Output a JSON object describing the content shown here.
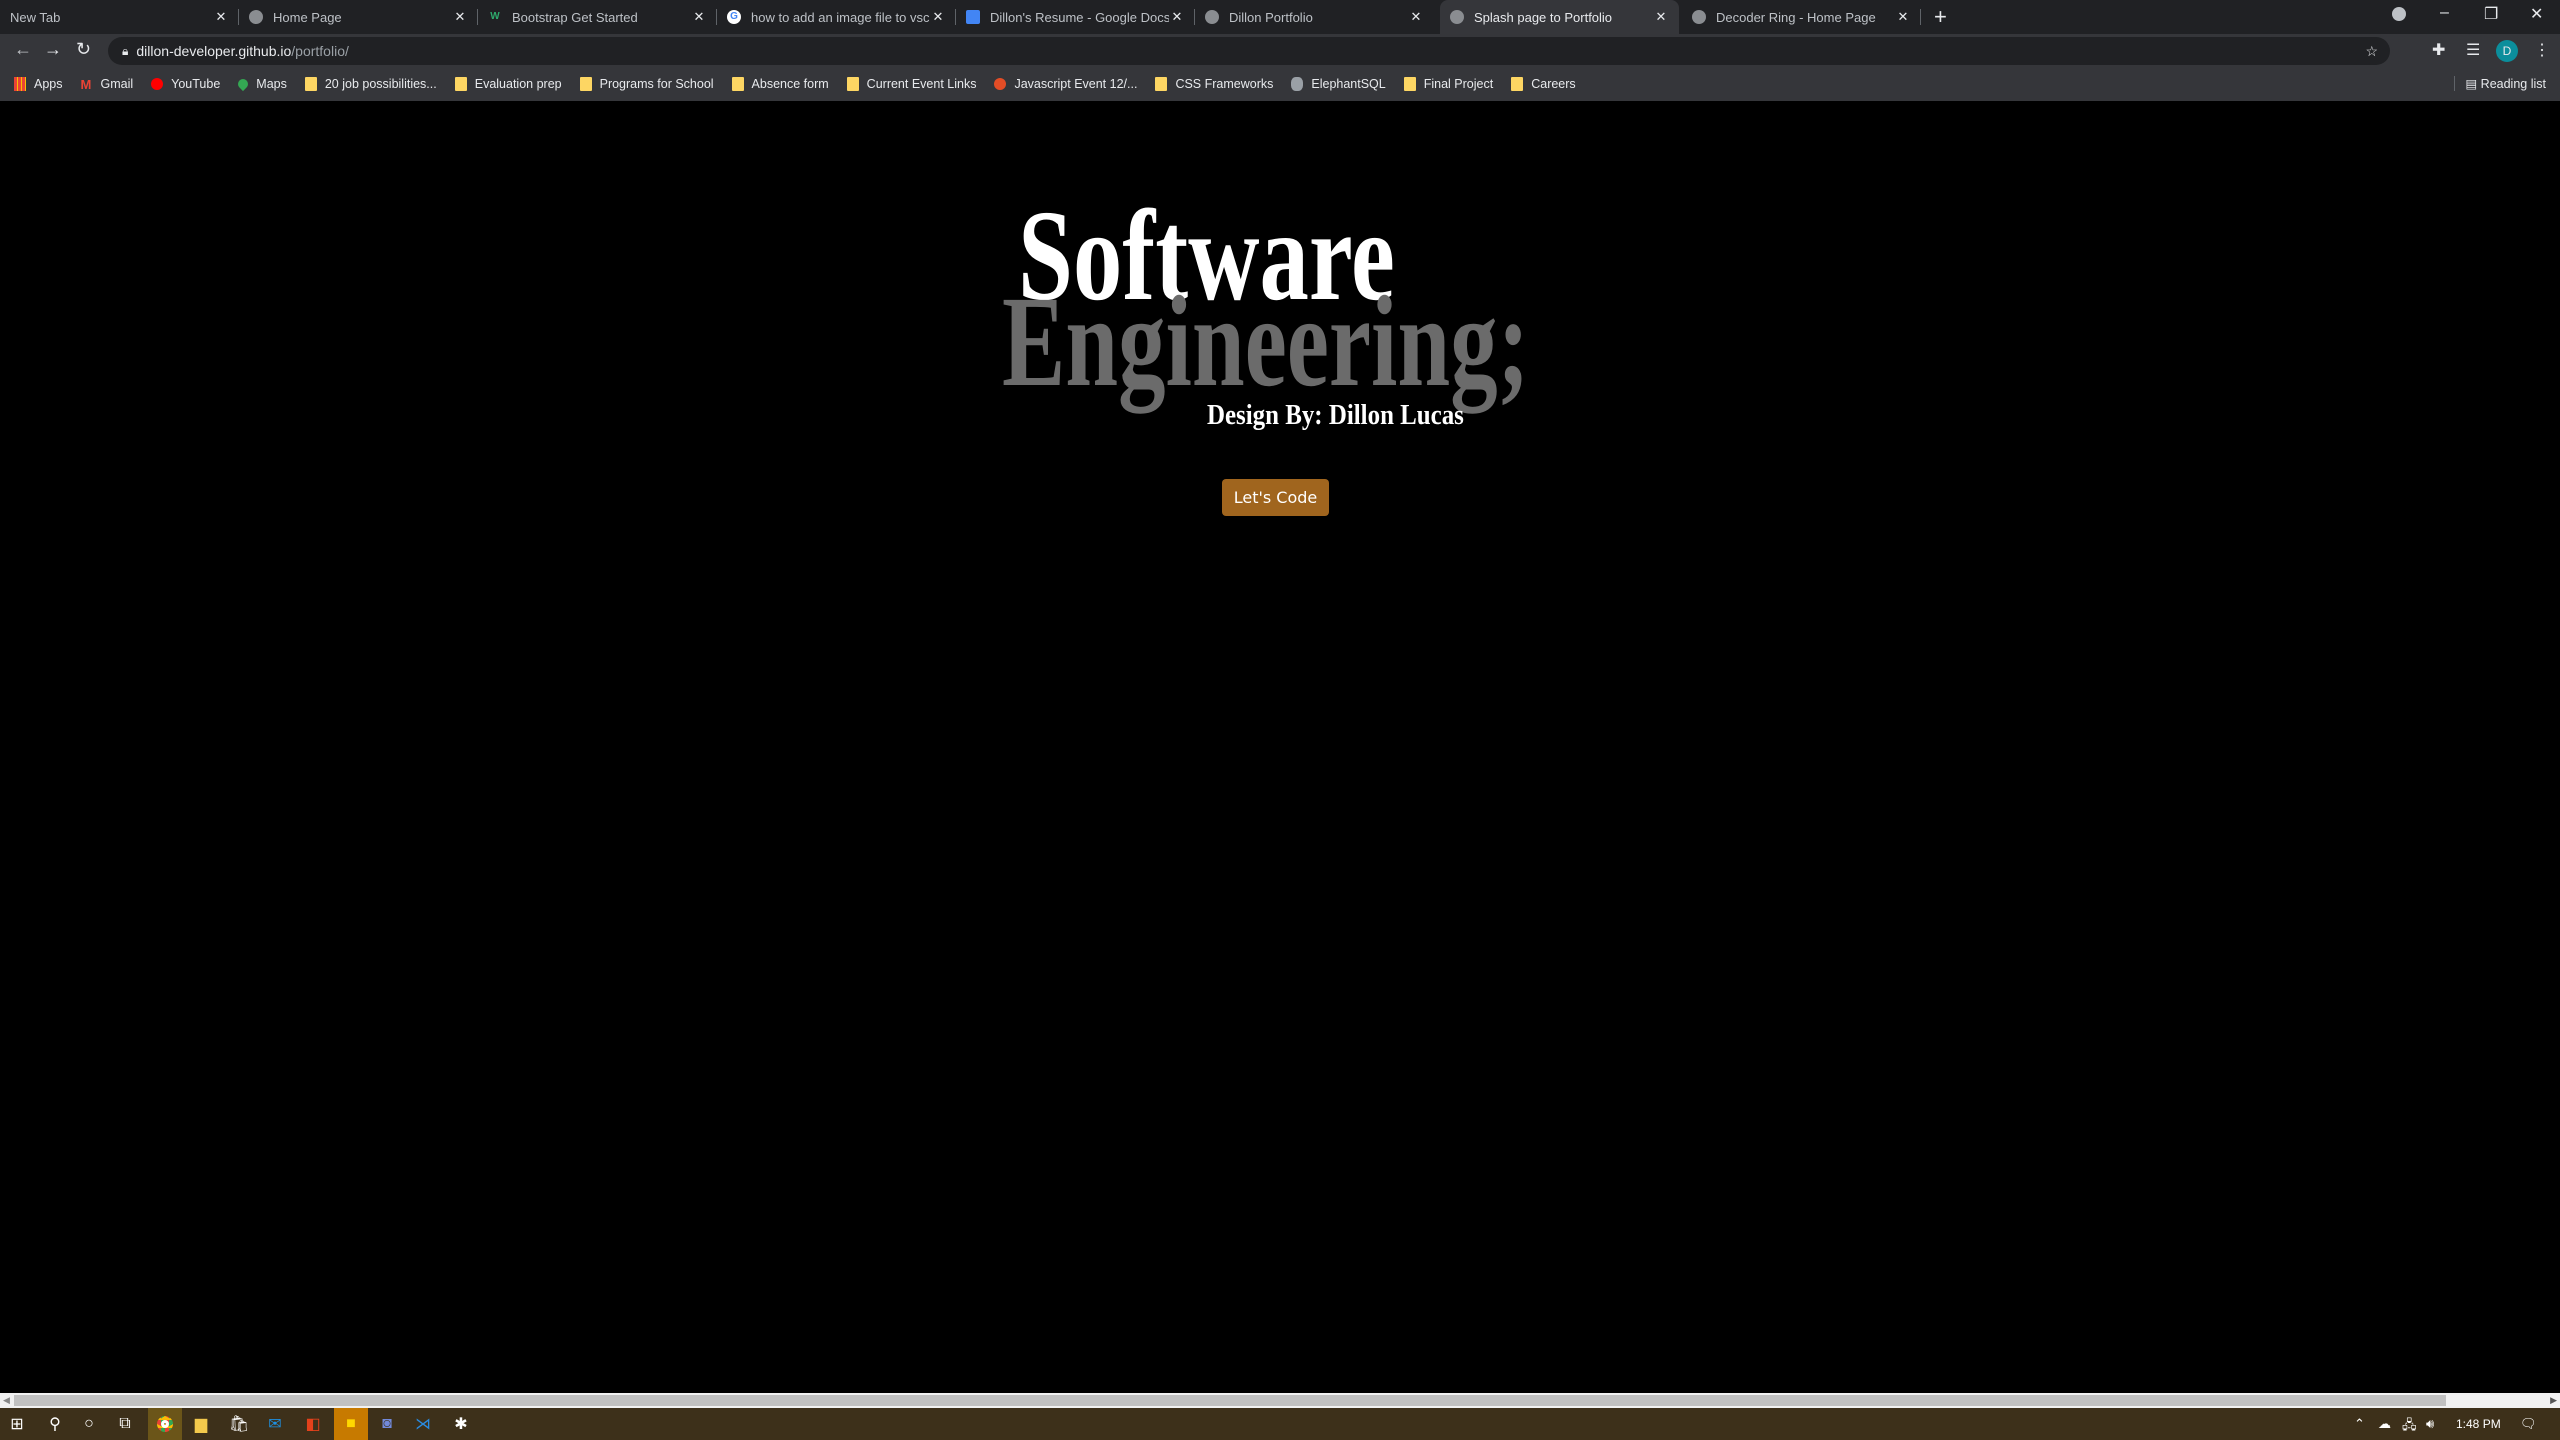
{
  "browser": {
    "tabs": [
      {
        "title": "New Tab",
        "active": false
      },
      {
        "title": "Home Page",
        "active": false
      },
      {
        "title": "Bootstrap Get Started",
        "active": false
      },
      {
        "title": "how to add an image file to vsco",
        "active": false
      },
      {
        "title": "Dillon's Resume - Google Docs",
        "active": false
      },
      {
        "title": "Dillon Portfolio",
        "active": false
      },
      {
        "title": "Splash page to Portfolio",
        "active": true
      },
      {
        "title": "Decoder Ring - Home Page",
        "active": false
      }
    ],
    "url_host": "dillon-developer.github.io",
    "url_path": "/portfolio/",
    "profile_initial": "D",
    "bookmarks": [
      "Apps",
      "Gmail",
      "YouTube",
      "Maps",
      "20 job possibilities...",
      "Evaluation prep",
      "Programs for School",
      "Absence form",
      "Current Event Links",
      "Javascript Event 12/...",
      "CSS Frameworks",
      "ElephantSQL",
      "Final Project",
      "Careers"
    ],
    "reading_list": "Reading list"
  },
  "page": {
    "title_line1": "Software",
    "title_line2": "Engineering;",
    "byline": "Design By: Dillon Lucas",
    "cta_label": "Let's Code",
    "colors": {
      "background": "#000000",
      "line1": "#ffffff",
      "line2": "#6b6b6b",
      "button": "#a0651e"
    }
  },
  "taskbar": {
    "time": "1:48 PM"
  }
}
